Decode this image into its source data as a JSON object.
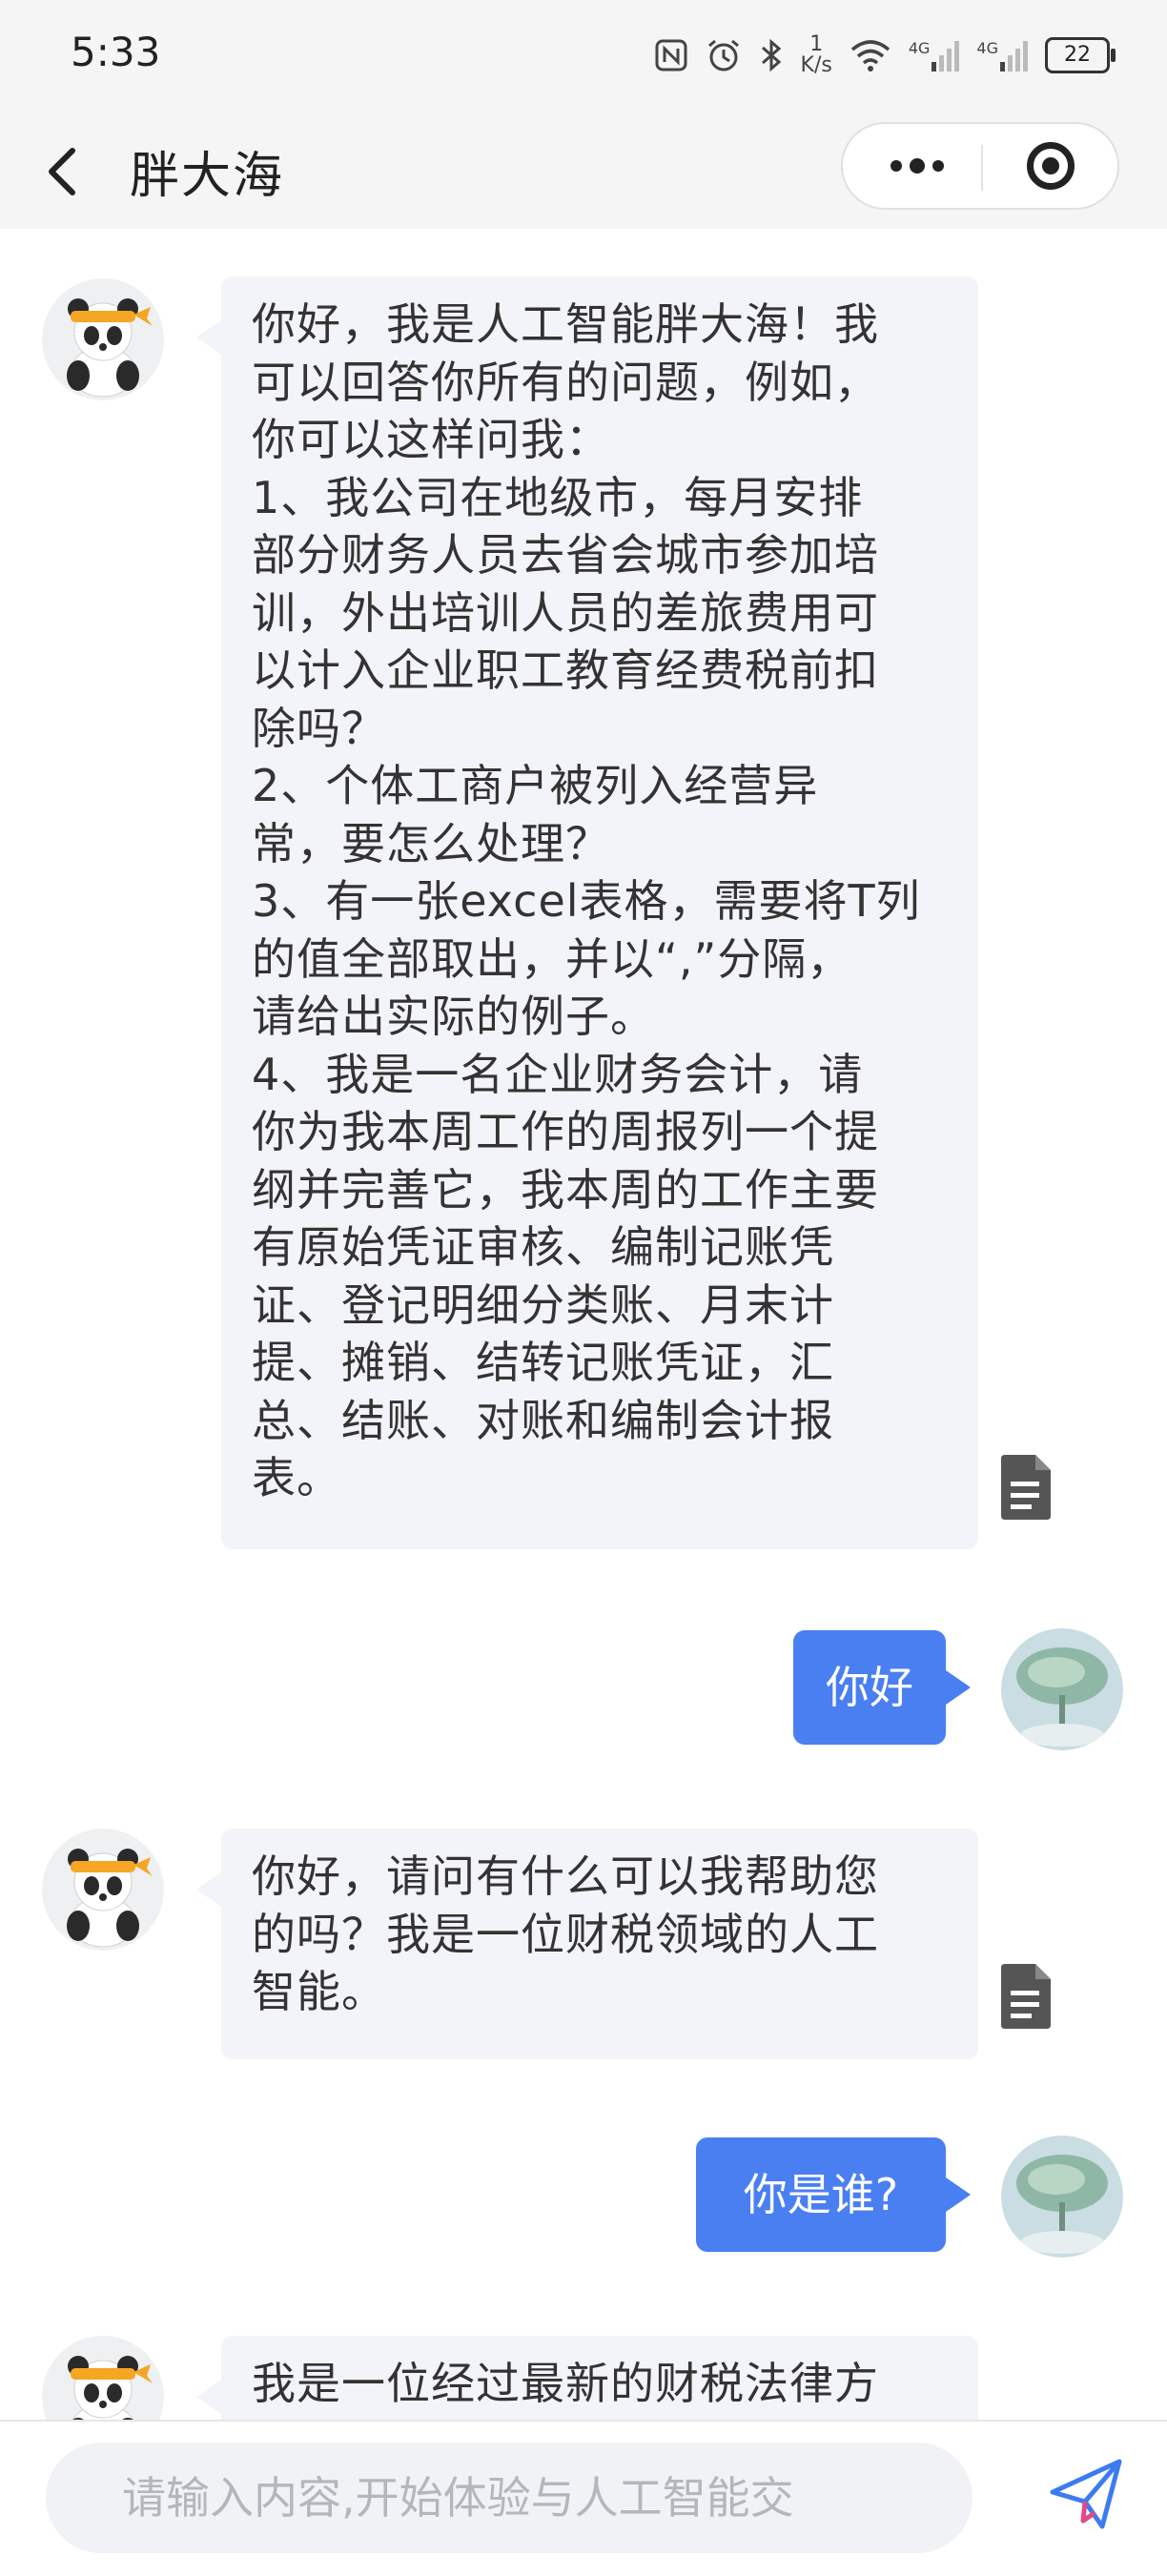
{
  "status_bar": {
    "time": "5:33",
    "net_speed_value": "1",
    "net_speed_unit": "K/s",
    "net_type_1": "4G",
    "net_type_2": "4G",
    "battery": "22"
  },
  "header": {
    "title": "胖大海",
    "icons": [
      "back-icon",
      "more-icon",
      "close-miniprogram-icon"
    ]
  },
  "messages": [
    {
      "role": "assistant",
      "lines": [
        "你好，我是人工智能胖大海！我",
        "可以回答你所有的问题，例如，",
        "你可以这样问我：",
        "1、我公司在地级市，每月安排",
        "部分财务人员去省会城市参加培",
        "训，外出培训人员的差旅费用可",
        "以计入企业职工教育经费税前扣",
        "除吗？",
        "2、个体工商户被列入经营异",
        "常，要怎么处理？",
        "3、有一张excel表格，需要将T列",
        "的值全部取出，并以“,”分隔，",
        "请给出实际的例子。",
        "4、我是一名企业财务会计，请",
        "你为我本周工作的周报列一个提",
        "纲并完善它，我本周的工作主要",
        "有原始凭证审核、编制记账凭",
        "证、登记明细分类账、月末计",
        "提、摊销、结转记账凭证，汇",
        "总、结账、对账和编制会计报",
        "表。"
      ]
    },
    {
      "role": "user",
      "text": "你好"
    },
    {
      "role": "assistant",
      "lines": [
        "你好，请问有什么可以我帮助您",
        "的吗？我是一位财税领域的人工",
        "智能。"
      ]
    },
    {
      "role": "user",
      "text": "你是谁?"
    },
    {
      "role": "assistant",
      "lines": [
        "我是一位经过最新的财税法律方"
      ]
    }
  ],
  "input": {
    "placeholder": "请输入内容,开始体验与人工智能交",
    "value": ""
  },
  "colors": {
    "user_bubble": "#4a7ff2",
    "assistant_bubble": "#f3f4fa",
    "header_bg": "#f5f5f5",
    "send_icon": "#3d7bf0"
  }
}
